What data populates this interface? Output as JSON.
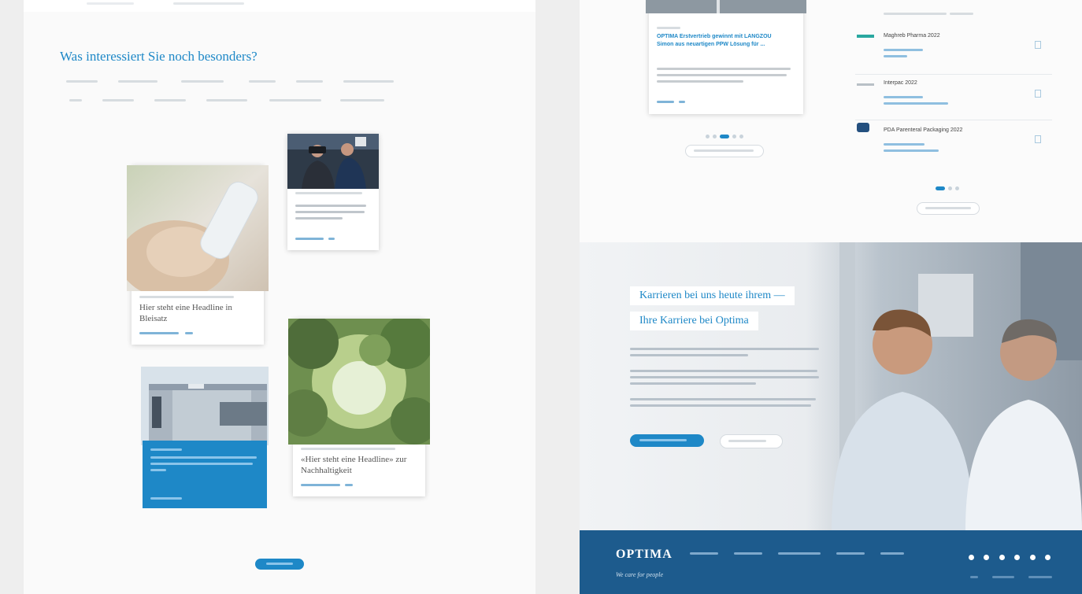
{
  "left_page": {
    "section_title": "Was interessiert Sie noch besonders?",
    "cards": [
      {
        "headline": "Hier steht eine Headline in Bleisatz"
      },
      {
        "headline": "Hier steht eine Headline in Bleisatz"
      },
      {
        "headline": "«Hier steht eine Headline» zur Nachhaltigkeit"
      }
    ]
  },
  "right_page": {
    "news_card_title": "OPTIMA Erstvertrieb gewinnt mit LANGZOU Simon aus neuartigen PPW Lösung für ... ",
    "events": [
      {
        "title": "Maghreb Pharma 2022"
      },
      {
        "title": "Interpac 2022"
      },
      {
        "title": "PDA Parenteral Packaging 2022"
      }
    ],
    "career": {
      "headline_1": "Karrieren bei uns heute ihrem —",
      "headline_2": "Ihre Karriere bei Optima"
    },
    "footer": {
      "logo": "OPTIMA",
      "tagline": "We care for people"
    }
  },
  "colors": {
    "accent": "#1e88c7",
    "footer": "#1d5b8d"
  }
}
